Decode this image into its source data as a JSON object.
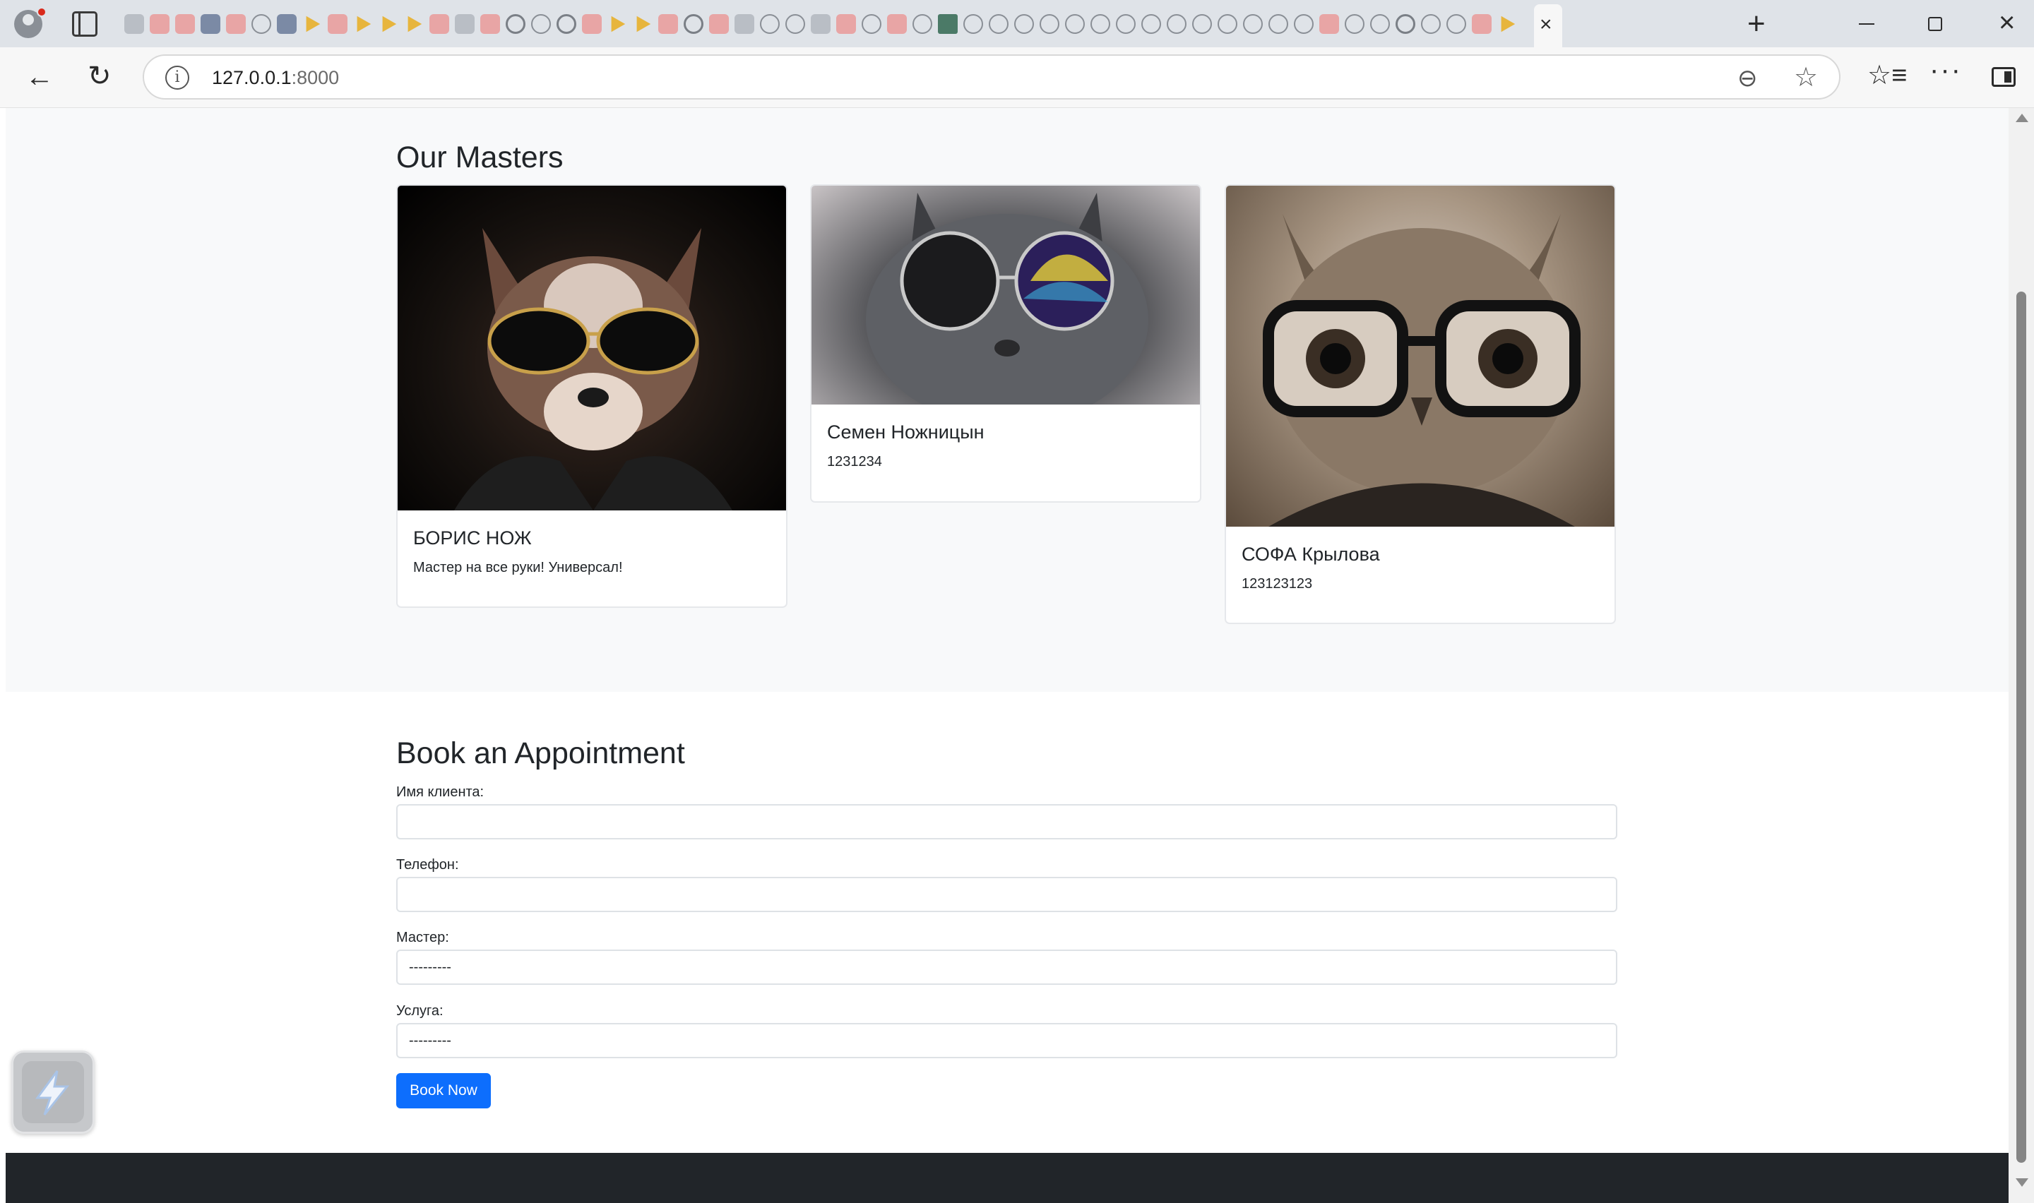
{
  "browser": {
    "tab_count_icons": [
      "ya",
      "gh",
      "globe",
      "yt",
      "rd",
      "dj"
    ],
    "url_host": "127.0.0.1",
    "url_port": ":8000"
  },
  "icons": {
    "back": "←",
    "reload": "↻",
    "info": "i",
    "zoom": "⊖",
    "star": "☆",
    "favorites": "☆≡",
    "more": "···",
    "new_tab": "+",
    "close_tab": "×",
    "window_close": "×"
  },
  "masters": {
    "title": "Our Masters",
    "cards": [
      {
        "name": "БОРИС НОЖ",
        "description": "Мастер на все руки! Универсал!"
      },
      {
        "name": "Семен Ножницын",
        "description": "1231234"
      },
      {
        "name": "СОФА Крылова",
        "description": "123123123"
      }
    ]
  },
  "booking": {
    "title": "Book an Appointment",
    "client_name_label": "Имя клиента:",
    "client_name_value": "",
    "phone_label": "Телефон:",
    "phone_value": "",
    "master_label": "Мастер:",
    "master_selected": "---------",
    "service_label": "Услуга:",
    "service_selected": "---------",
    "submit_label": "Book Now"
  },
  "colors": {
    "primary": "#0d6efd",
    "footer": "#212529",
    "section_bg": "#f8f9fa"
  }
}
